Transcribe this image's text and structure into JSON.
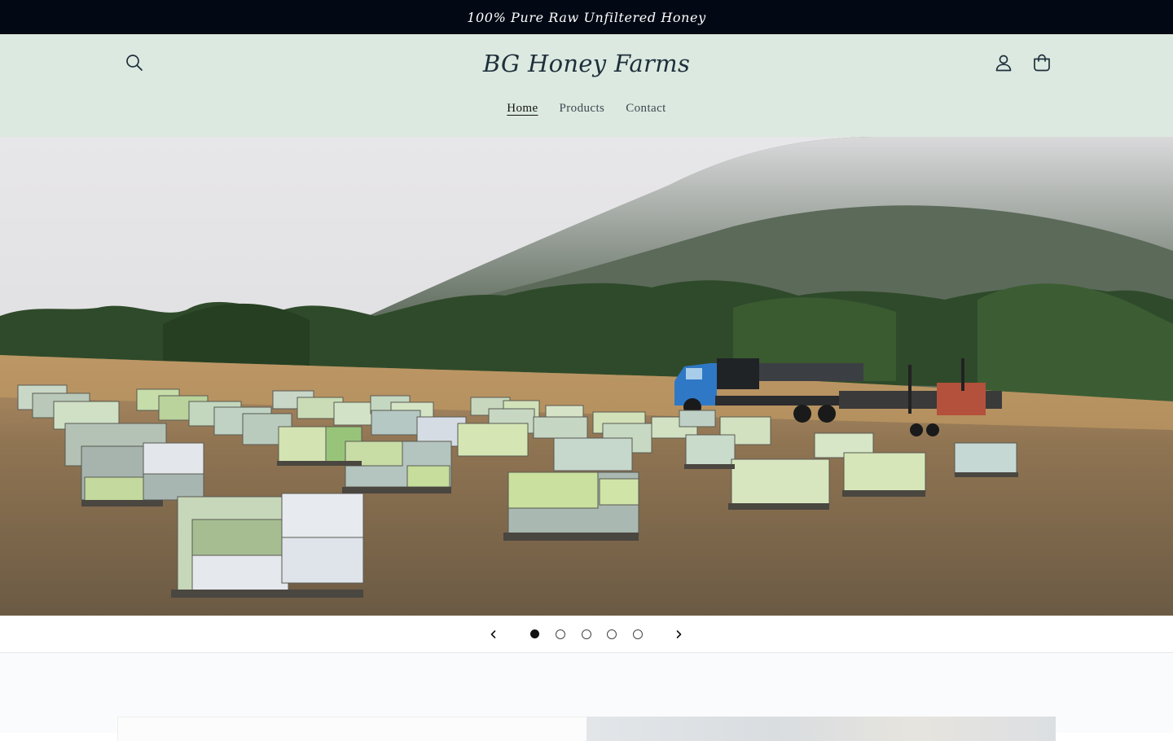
{
  "announcement": {
    "text": "100% Pure Raw Unfiltered Honey"
  },
  "header": {
    "logo": "BG Honey Farms",
    "nav": [
      {
        "label": "Home",
        "active": true
      },
      {
        "label": "Products",
        "active": false
      },
      {
        "label": "Contact",
        "active": false
      }
    ],
    "icons": {
      "search": "search-icon",
      "account": "account-icon",
      "cart": "cart-icon"
    }
  },
  "hero": {
    "image": "apiary-field-with-beehives-truck-and-forklift",
    "slides_total": 5,
    "active_slide": 1
  },
  "slider": {
    "prev": "chevron-left-icon",
    "next": "chevron-right-icon"
  },
  "colors": {
    "announcement_bg": "#020914",
    "header_bg": "#dce9e0",
    "logo": "#1e2f3b"
  }
}
